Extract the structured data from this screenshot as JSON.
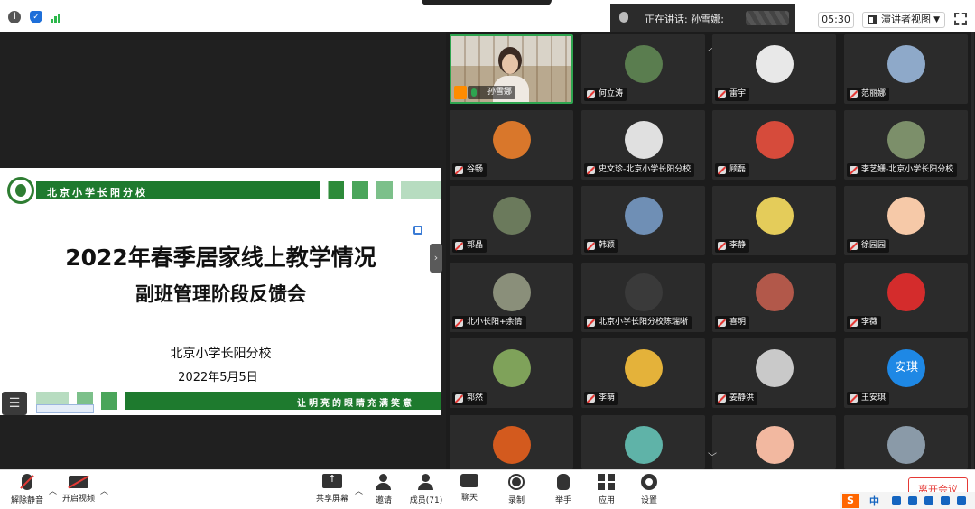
{
  "topbar": {
    "speaking_label": "正在讲话: 孙雪娜;",
    "timer": "05:30",
    "view_label": "演讲者视图"
  },
  "slide": {
    "school_tag": "北京小学长阳分校",
    "title_line1": "2022年春季居家线上教学情况",
    "title_line2": "副班管理阶段反馈会",
    "school": "北京小学长阳分校",
    "date": "2022年5月5日",
    "motto": "让明亮的眼睛充满笑意"
  },
  "gallery": {
    "participants": [
      {
        "name": "孙雪娜",
        "video": true,
        "color": "#c9b9a0"
      },
      {
        "name": "何立涛",
        "color": "#5a7d4f"
      },
      {
        "name": "雷宇",
        "color": "#e8e8e8"
      },
      {
        "name": "范丽娜",
        "color": "#8ea9c9"
      },
      {
        "name": "谷畅",
        "color": "#d9772b"
      },
      {
        "name": "史文珍-北京小学长阳分校",
        "color": "#e0e0e0"
      },
      {
        "name": "顾磊",
        "color": "#d64b3b"
      },
      {
        "name": "李艺姗-北京小学长阳分校",
        "color": "#7c8f6a"
      },
      {
        "name": "郭晶",
        "color": "#6b7a5c"
      },
      {
        "name": "韩颖",
        "color": "#6f8fb5"
      },
      {
        "name": "李静",
        "color": "#e4cc5a"
      },
      {
        "name": "徐园园",
        "color": "#f6c9a8"
      },
      {
        "name": "北小长阳+余倩",
        "color": "#8a8f7a"
      },
      {
        "name": "北京小学长阳分校陈瑞晰",
        "color": "#3a3a3a"
      },
      {
        "name": "喜明",
        "color": "#b2584a"
      },
      {
        "name": "李薇",
        "color": "#d42c2c"
      },
      {
        "name": "郭然",
        "color": "#7fa25a"
      },
      {
        "name": "李萌",
        "color": "#e4b23a"
      },
      {
        "name": "姜静洪",
        "color": "#c9c9c9"
      },
      {
        "name": "王安琪",
        "color": "#1e88e5",
        "initials": "安琪"
      },
      {
        "name": "",
        "color": "#d35a1e"
      },
      {
        "name": "",
        "color": "#5fb3a8"
      },
      {
        "name": "",
        "color": "#f2b8a0"
      },
      {
        "name": "",
        "color": "#8a9aa8"
      }
    ]
  },
  "toolbar": {
    "unmute": "解除静音",
    "start_video": "开启视频",
    "share_screen": "共享屏幕",
    "invite": "邀请",
    "members": "成员(71)",
    "chat": "聊天",
    "record": "录制",
    "raise_hand": "举手",
    "apps": "应用",
    "settings": "设置",
    "leave": "离开会议"
  },
  "ime": {
    "s_label": "S",
    "lang": "中"
  }
}
